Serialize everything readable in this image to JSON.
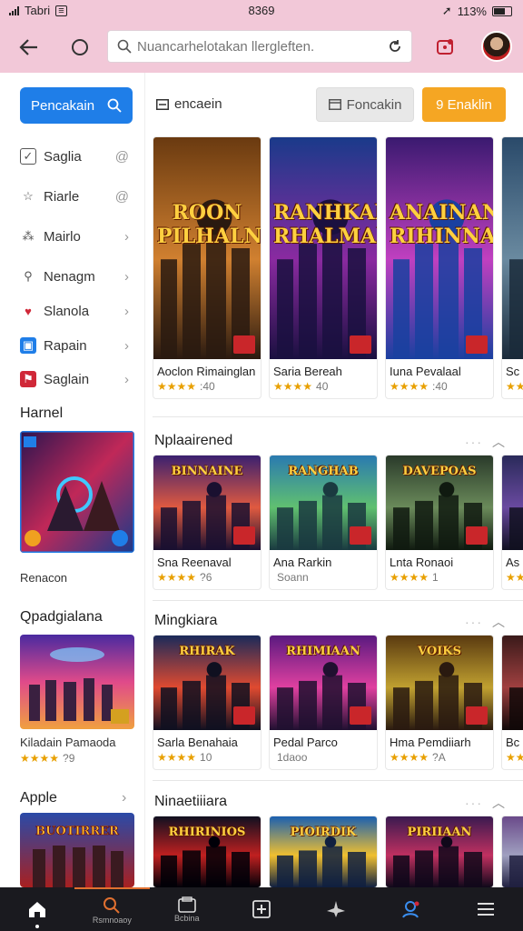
{
  "status": {
    "carrier": "Tabri",
    "time": "8369",
    "battery": "113%"
  },
  "topbar": {
    "search_placeholder": "Nuancarhelotakan llergleften."
  },
  "sidebar": {
    "category_button": "Pencakain",
    "items": [
      {
        "label": "Saglia",
        "icon": "checklist-icon",
        "right": "@"
      },
      {
        "label": "Riarle",
        "icon": "star-outline-icon",
        "right": "@"
      },
      {
        "label": "Mairlo",
        "icon": "puzzle-icon",
        "right": "›"
      },
      {
        "label": "Nenagm",
        "icon": "search-icon",
        "right": "›"
      },
      {
        "label": "Slanola",
        "icon": "heart-icon",
        "right": "›"
      },
      {
        "label": "Rapain",
        "icon": "photo-icon",
        "right": "›"
      },
      {
        "label": "Saglain",
        "icon": "flag-icon",
        "right": "›"
      }
    ],
    "section1_title": "Harnel",
    "section1_card_label": "Renacon",
    "section2_title": "Qpadgialana",
    "section2_card_name": "Kiladain Pamaoda",
    "section2_card_rating": "★★★★",
    "section2_card_score": "?9",
    "section3_title": "Apple"
  },
  "filters": {
    "left_label": "encaein",
    "gray_button": "Foncakin",
    "orange_button": "9 Enaklin"
  },
  "sections": [
    {
      "title": "",
      "cards": [
        {
          "name": "Aoclon Rimainglan",
          "rating": "★★★★",
          "score": ":40",
          "art_title": "ROON PILHALNAI"
        },
        {
          "name": "Saria Bereah",
          "rating": "★★★★",
          "score": "40",
          "art_title": "RANHKAN RHALMAN"
        },
        {
          "name": "Iuna Pevalaal",
          "rating": "★★★★",
          "score": ":40",
          "art_title": "ANAINAN RIHINNAS"
        },
        {
          "name": "Sc",
          "rating": "★★",
          "score": "",
          "art_title": ""
        }
      ]
    },
    {
      "title": "Nplaairened",
      "cards": [
        {
          "name": "Sna Reenaval",
          "rating": "★★★★",
          "score": "?6",
          "art_title": "BINNAINE"
        },
        {
          "name": "Ana Rarkin",
          "rating": "",
          "score": "Soann",
          "art_title": "RANGHAB"
        },
        {
          "name": "Lnta Ronaoi",
          "rating": "★★★★",
          "score": "1",
          "art_title": "DAVEPOAS"
        },
        {
          "name": "As",
          "rating": "★★",
          "score": "",
          "art_title": ""
        }
      ]
    },
    {
      "title": "Mingkiara",
      "cards": [
        {
          "name": "Sarla Benahaia",
          "rating": "★★★★",
          "score": "10",
          "art_title": "RHIRAK"
        },
        {
          "name": "Pedal Parco",
          "rating": "",
          "score": "1daoo",
          "art_title": "RHIMIAAN"
        },
        {
          "name": "Hma Pemdiiarh",
          "rating": "★★★★",
          "score": "?A",
          "art_title": "VOIKS"
        },
        {
          "name": "Bc",
          "rating": "★★",
          "score": "",
          "art_title": ""
        }
      ]
    },
    {
      "title": "Ninaetiiiara",
      "cards": [
        {
          "name": "",
          "rating": "",
          "score": "",
          "art_title": "RHIRINIOS"
        },
        {
          "name": "",
          "rating": "",
          "score": "",
          "art_title": "PIOIRDIK"
        },
        {
          "name": "",
          "rating": "",
          "score": "",
          "art_title": "PIRIIAAN"
        },
        {
          "name": "",
          "rating": "",
          "score": "",
          "art_title": ""
        }
      ]
    }
  ],
  "bottom_nav": [
    {
      "icon": "home-icon",
      "label": ""
    },
    {
      "icon": "search-icon",
      "label": "Rsmnoaoy"
    },
    {
      "icon": "library-icon",
      "label": "Bcbina"
    },
    {
      "icon": "add-icon",
      "label": ""
    },
    {
      "icon": "plane-icon",
      "label": ""
    },
    {
      "icon": "profile-icon",
      "label": ""
    },
    {
      "icon": "menu-icon",
      "label": ""
    }
  ],
  "colors": {
    "header_bg": "#f2c8d8",
    "accent_blue": "#1f7ee8",
    "accent_orange": "#f5a623",
    "nav_bg": "#1a1a1f",
    "star": "#e8a000"
  }
}
